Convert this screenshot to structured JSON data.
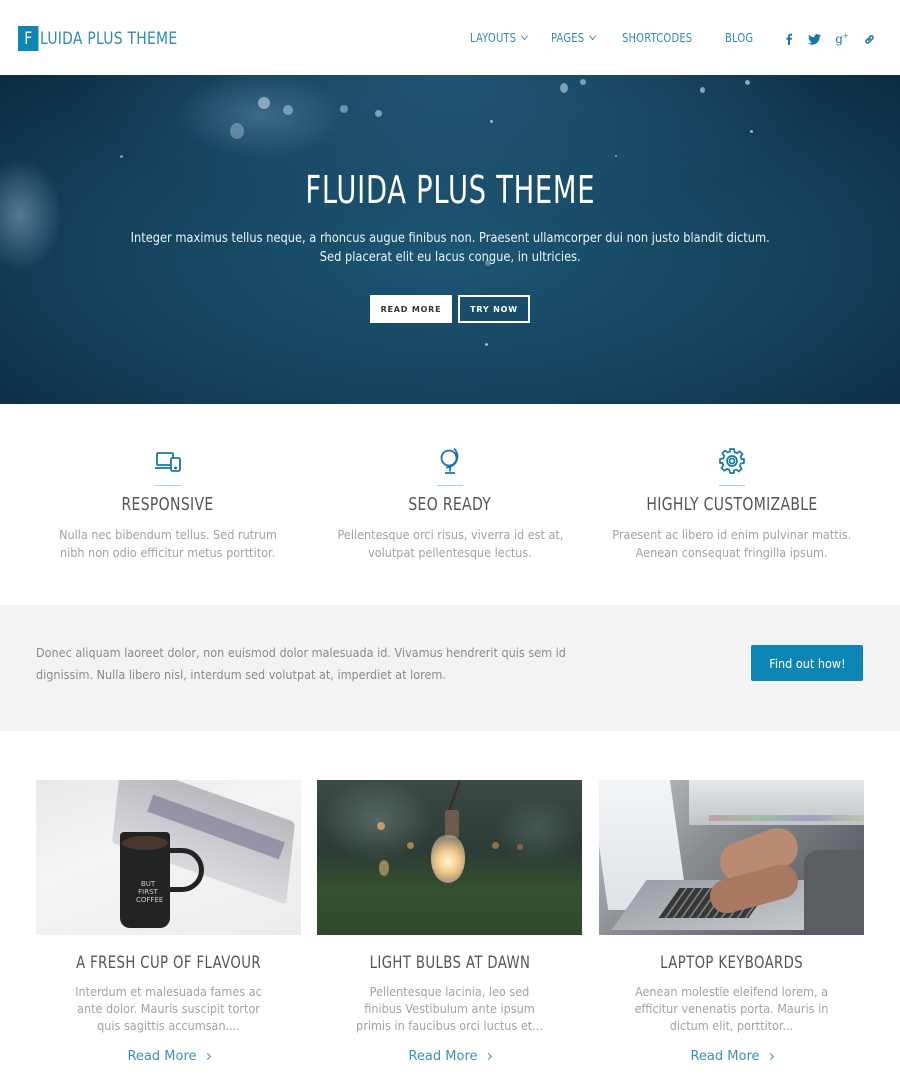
{
  "header": {
    "logo_letter": "F",
    "logo_text": "LUIDA PLUS THEME",
    "nav": [
      {
        "label": "LAYOUTS",
        "has_dropdown": true
      },
      {
        "label": "PAGES",
        "has_dropdown": true
      },
      {
        "label": "SHORTCODES",
        "has_dropdown": false
      },
      {
        "label": "BLOG",
        "has_dropdown": false
      }
    ],
    "social": [
      {
        "name": "facebook-icon"
      },
      {
        "name": "twitter-icon"
      },
      {
        "name": "google-plus-icon"
      },
      {
        "name": "link-icon"
      }
    ]
  },
  "hero": {
    "title": "FLUIDA PLUS THEME",
    "text_line1": "Integer maximus tellus neque, a rhoncus augue finibus non. Praesent ullamcorper dui non justo blandit dictum.",
    "text_line2": "Sed placerat elit eu lacus congue, in ultricies.",
    "buttons": [
      {
        "label": "READ MORE"
      },
      {
        "label": "TRY NOW"
      }
    ]
  },
  "features": [
    {
      "icon": "responsive-devices-icon",
      "title": "RESPONSIVE",
      "line1": "Nulla nec bibendum tellus. Sed rutrum",
      "line2": "nibh non odio efficitur metus porttitor."
    },
    {
      "icon": "globe-icon",
      "title": "SEO READY",
      "line1": "Pellentesque orci risus, viverra id est at,",
      "line2": "volutpat pellentesque lectus."
    },
    {
      "icon": "gear-icon",
      "title": "HIGHLY CUSTOMIZABLE",
      "line1": "Praesent ac libero id enim pulvinar mattis.",
      "line2": "Aenean consequat fringilla ipsum."
    }
  ],
  "cta": {
    "text": "Donec aliquam laoreet dolor, non euismod dolor malesuada id. Vivamus hendrerit quis sem id dignissim. Nulla libero nisl, interdum sed volutpat at, imperdiet at lorem.",
    "button_label": "Find out how!"
  },
  "posts": [
    {
      "image": "coffee-mug-laptop-photo",
      "title": "A FRESH CUP OF FLAVOUR",
      "excerpt": "Interdum et malesuada fames ac ante dolor. Mauris suscipit tortor quis sagittis accumsan....",
      "read_more": "Read More"
    },
    {
      "image": "light-bulb-photo",
      "title": "LIGHT BULBS AT DAWN",
      "excerpt": "Pellentesque lacinia, leo sed finibus Vestibulum ante ipsum primis in faucibus orci luctus et...",
      "read_more": "Read More"
    },
    {
      "image": "laptop-typing-photo",
      "title": "LAPTOP KEYBOARDS",
      "excerpt": "Aenean molestie eleifend lorem, a efficitur venenatis porta. Mauris in dictum elit, porttitor...",
      "read_more": "Read More"
    }
  ],
  "colors": {
    "accent": "#0d85b5",
    "nav_text": "#2f8ab8",
    "band_bg": "#f3f3f3"
  }
}
